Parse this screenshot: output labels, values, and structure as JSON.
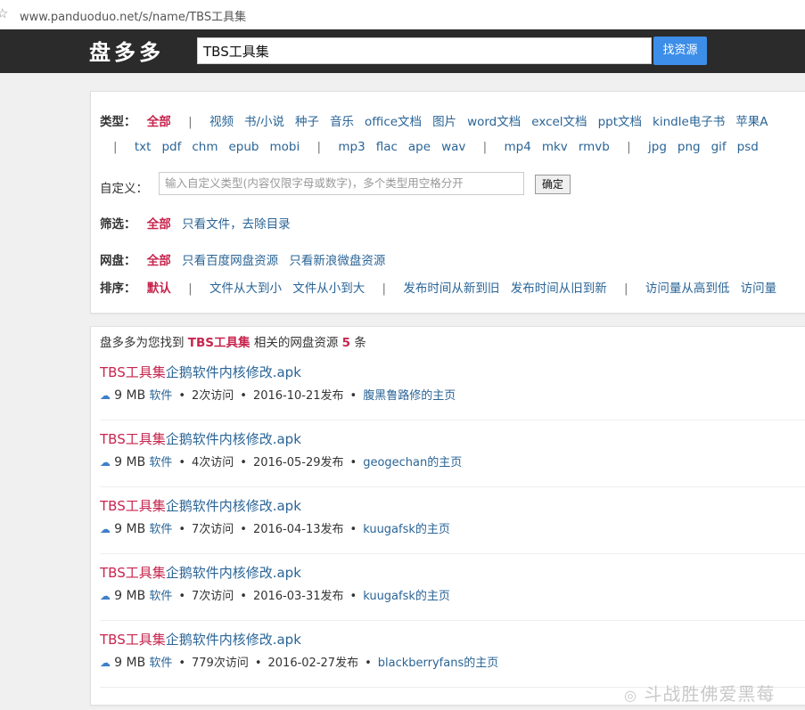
{
  "browser": {
    "url": "www.panduoduo.net/s/name/TBS工具集"
  },
  "header": {
    "logo": "盘多多",
    "search_value": "TBS工具集",
    "search_button": "找资源"
  },
  "filters": {
    "type_label": "类型：",
    "type_all": "全部",
    "types_row1": [
      "视频",
      "书/小说",
      "种子",
      "音乐",
      "office文档",
      "图片",
      "word文档",
      "excel文档",
      "ppt文档",
      "kindle电子书",
      "苹果A"
    ],
    "types_row2_g1": [
      "txt",
      "pdf",
      "chm",
      "epub",
      "mobi"
    ],
    "types_row2_g2": [
      "mp3",
      "flac",
      "ape",
      "wav"
    ],
    "types_row2_g3": [
      "mp4",
      "mkv",
      "rmvb"
    ],
    "types_row2_g4": [
      "jpg",
      "png",
      "gif",
      "psd"
    ],
    "custom_label": "自定义：",
    "custom_placeholder": "输入自定义类型(内容仅限字母或数字)，多个类型用空格分开",
    "confirm_label": "确定",
    "screen_label": "筛选：",
    "screen_all": "全部",
    "screen_files_only": "只看文件，去除目录",
    "disk_label": "网盘：",
    "disk_all": "全部",
    "disk_baidu": "只看百度网盘资源",
    "disk_sina": "只看新浪微盘资源",
    "sort_label": "排序：",
    "sort_default": "默认",
    "sort_size_desc": "文件从大到小",
    "sort_size_asc": "文件从小到大",
    "sort_date_desc": "发布时间从新到旧",
    "sort_date_asc": "发布时间从旧到新",
    "sort_visits_desc": "访问量从高到低",
    "sort_visits_asc": "访问量"
  },
  "results": {
    "summary_prefix": "盘多多为您找到",
    "summary_keyword": "TBS工具集",
    "summary_middle": "相关的网盘资源",
    "summary_count": "5",
    "summary_suffix": "条",
    "items": [
      {
        "title_hl": "TBS工具集",
        "title_rest": "企鹅软件内核修改.apk",
        "size": "9 MB",
        "category": "软件",
        "visits": "2次访问",
        "date": "2016-10-21发布",
        "uploader": "腹黑鲁路修的主页"
      },
      {
        "title_hl": "TBS工具集",
        "title_rest": "企鹅软件内核修改.apk",
        "size": "9 MB",
        "category": "软件",
        "visits": "4次访问",
        "date": "2016-05-29发布",
        "uploader": "geogechan的主页"
      },
      {
        "title_hl": "TBS工具集",
        "title_rest": "企鹅软件内核修改.apk",
        "size": "9 MB",
        "category": "软件",
        "visits": "7次访问",
        "date": "2016-04-13发布",
        "uploader": "kuugafsk的主页"
      },
      {
        "title_hl": "TBS工具集",
        "title_rest": "企鹅软件内核修改.apk",
        "size": "9 MB",
        "category": "软件",
        "visits": "7次访问",
        "date": "2016-03-31发布",
        "uploader": "kuugafsk的主页"
      },
      {
        "title_hl": "TBS工具集",
        "title_rest": "企鹅软件内核修改.apk",
        "size": "9 MB",
        "category": "软件",
        "visits": "779次访问",
        "date": "2016-02-27发布",
        "uploader": "blackberryfans的主页"
      }
    ]
  },
  "watermark": "斗战胜佛爱黑莓",
  "icons": {
    "bookmark": "star-icon",
    "cloud": "cloud-icon"
  },
  "colors": {
    "header_bg": "#2b2b2b",
    "accent": "#c7254e",
    "link": "#2a6496",
    "button": "#3d8ee8"
  }
}
